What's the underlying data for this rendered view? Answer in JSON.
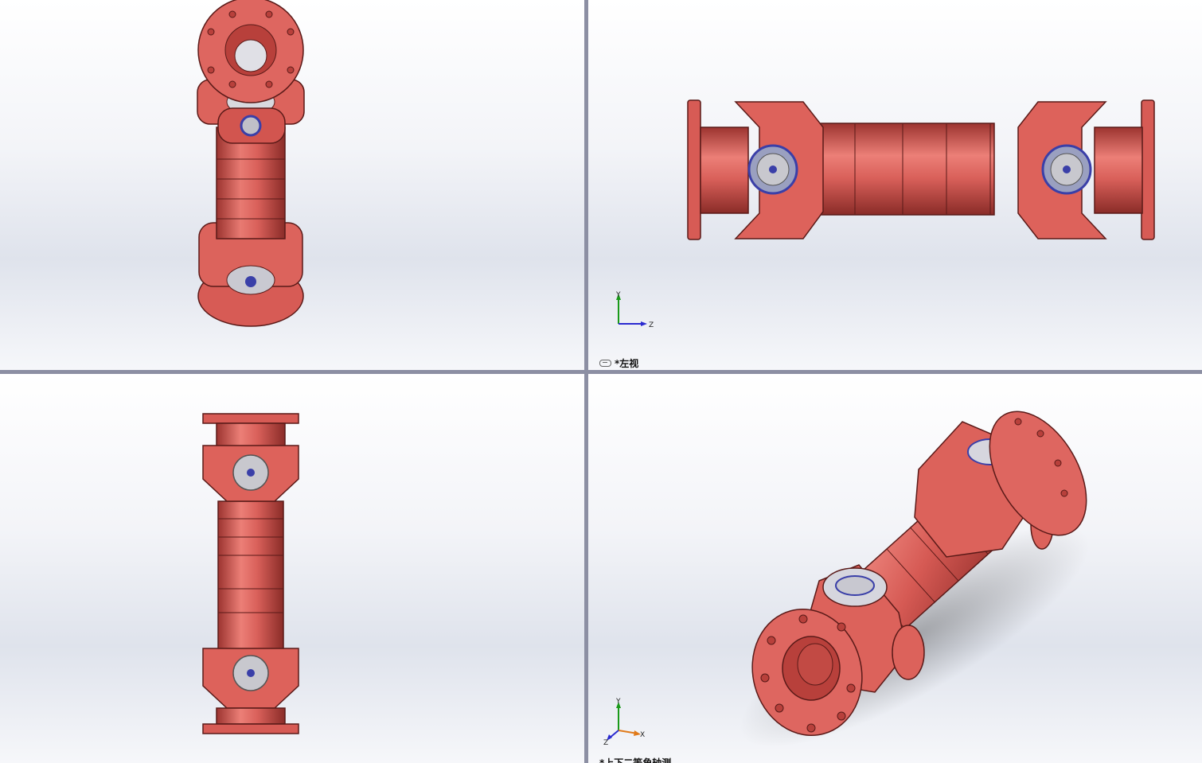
{
  "viewports": {
    "top_right": {
      "view_label": "*左视",
      "triad": {
        "up_axis": "Y",
        "right_axis": "Z"
      }
    },
    "bottom_right": {
      "view_label": "*上下二等角轴测",
      "triad": {
        "up_axis": "Y",
        "right_axis": "X",
        "down_axis": "Z"
      }
    }
  },
  "colors": {
    "part": "#e0665f",
    "part_dark": "#b8403b",
    "edge": "#5a1a18",
    "bearing": "#c0c0c8",
    "seal": "#3a3fa8",
    "viewport_border": "#8c8fa3"
  },
  "icons": [
    "link-icon",
    "axis-triad-icon"
  ]
}
